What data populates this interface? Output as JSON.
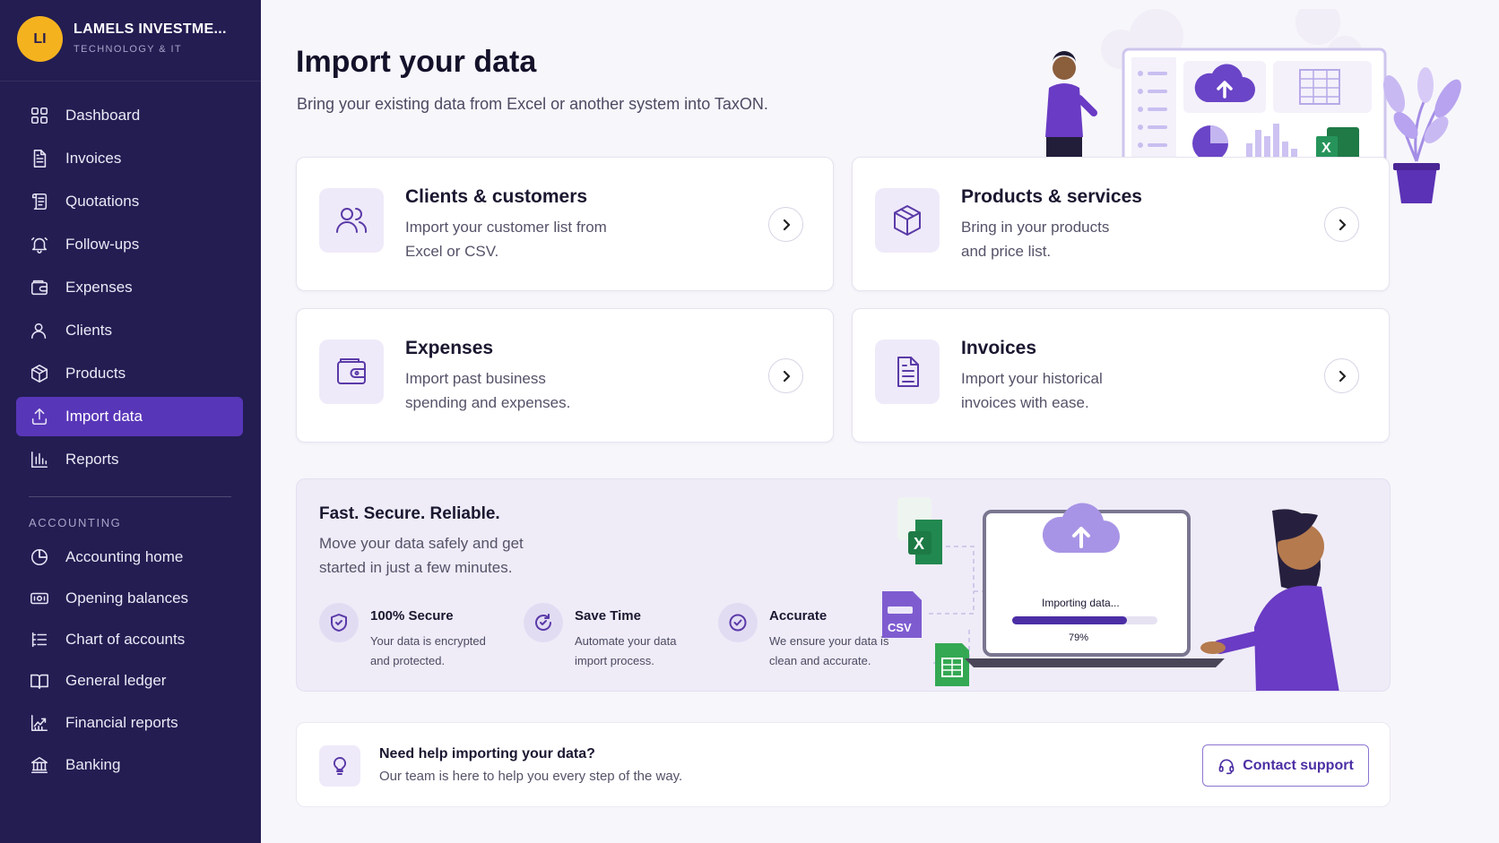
{
  "org": {
    "initials": "LI",
    "name": "LAMELS INVESTME...",
    "subtitle": "TECHNOLOGY & IT"
  },
  "nav": {
    "items": [
      {
        "label": "Dashboard",
        "icon": "grid-icon"
      },
      {
        "label": "Invoices",
        "icon": "document-icon"
      },
      {
        "label": "Quotations",
        "icon": "scroll-icon"
      },
      {
        "label": "Follow-ups",
        "icon": "bell-icon"
      },
      {
        "label": "Expenses",
        "icon": "wallet-icon"
      },
      {
        "label": "Clients",
        "icon": "user-icon"
      },
      {
        "label": "Products",
        "icon": "box-icon"
      },
      {
        "label": "Import data",
        "icon": "upload-icon",
        "active": true
      },
      {
        "label": "Reports",
        "icon": "bar-chart-icon"
      }
    ],
    "accounting_label": "ACCOUNTING",
    "accounting_items": [
      {
        "label": "Accounting home",
        "icon": "pie-chart-icon"
      },
      {
        "label": "Opening balances",
        "icon": "cash-icon"
      },
      {
        "label": "Chart of accounts",
        "icon": "list-tree-icon"
      },
      {
        "label": "General ledger",
        "icon": "book-icon"
      },
      {
        "label": "Financial reports",
        "icon": "trend-chart-icon"
      },
      {
        "label": "Banking",
        "icon": "bank-icon"
      }
    ]
  },
  "page": {
    "title": "Import your data",
    "subtitle": "Bring your existing data from Excel or another system into TaxON."
  },
  "cards": [
    {
      "title": "Clients & customers",
      "desc": "Import your customer list from Excel or CSV.",
      "icon": "users-icon"
    },
    {
      "title": "Products & services",
      "desc": "Bring in your products and price list.",
      "icon": "box-icon"
    },
    {
      "title": "Expenses",
      "desc": "Import past business spending and expenses.",
      "icon": "wallet-icon"
    },
    {
      "title": "Invoices",
      "desc": "Import your historical invoices with ease.",
      "icon": "document-icon"
    }
  ],
  "promo": {
    "title": "Fast. Secure. Reliable.",
    "desc": "Move your data safely and get started in just a few minutes.",
    "features": [
      {
        "title": "100% Secure",
        "desc": "Your data is encrypted and protected.",
        "icon": "shield-check-icon"
      },
      {
        "title": "Save Time",
        "desc": "Automate your data import process.",
        "icon": "refresh-check-icon"
      },
      {
        "title": "Accurate",
        "desc": "We ensure your data is clean and accurate.",
        "icon": "check-circle-icon"
      }
    ],
    "illustration": {
      "status": "Importing data...",
      "progress_label": "79%",
      "progress": 0.79,
      "excel_label": "X",
      "csv_label": "CSV"
    }
  },
  "help": {
    "title": "Need help importing your data?",
    "desc": "Our team is here to help you every step of the way.",
    "button": "Contact support"
  },
  "colors": {
    "sidebar": "#231d52",
    "accent": "#5836b8",
    "avatar": "#f5b21f",
    "icon_tint": "#5a3aa8"
  }
}
